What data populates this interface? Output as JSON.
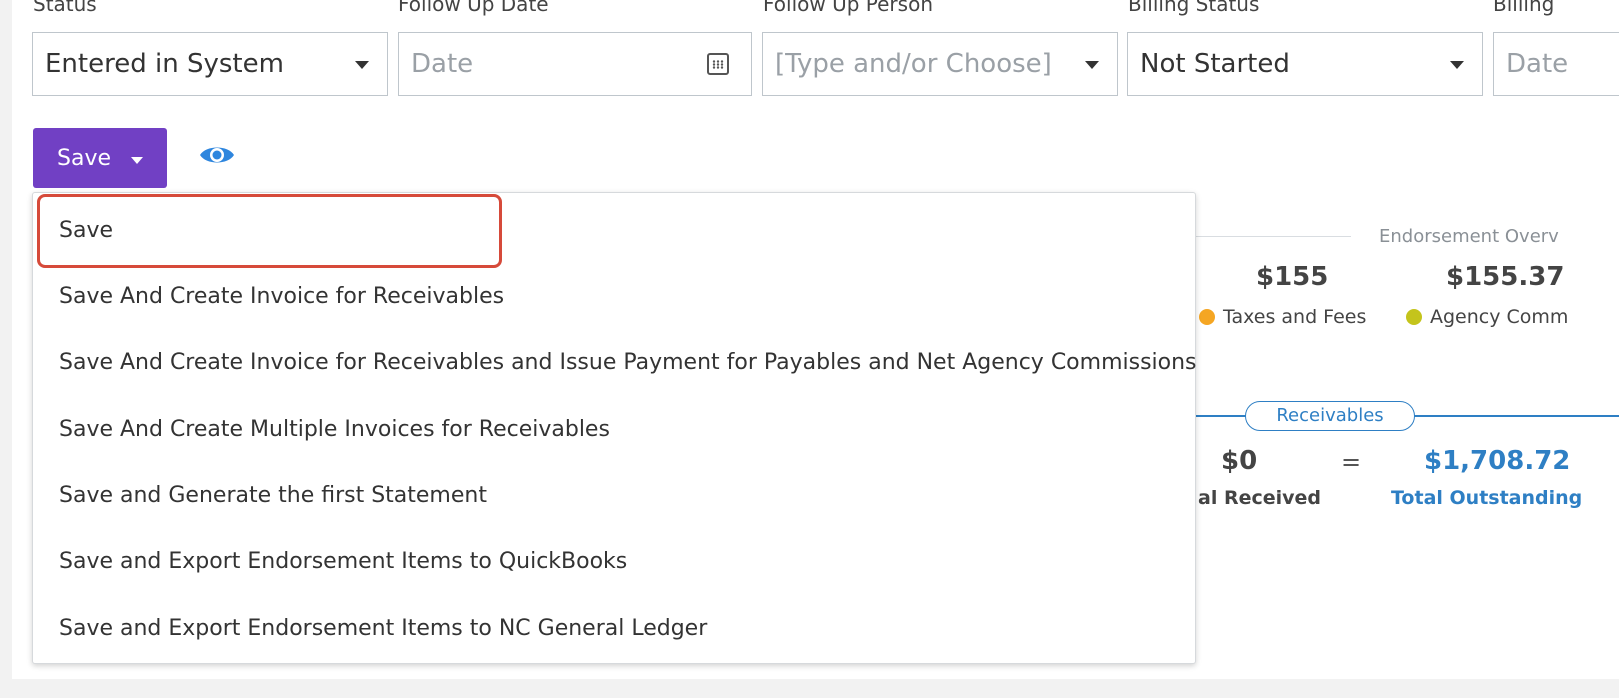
{
  "form": {
    "fields": [
      {
        "label": "Status",
        "value": "Entered in System",
        "placeholder": ""
      },
      {
        "label": "Follow Up Date",
        "value": "",
        "placeholder": "Date"
      },
      {
        "label": "Follow Up Person",
        "value": "",
        "placeholder": "[Type and/or Choose]"
      },
      {
        "label": "Billing Status",
        "value": "Not Started",
        "placeholder": ""
      },
      {
        "label": "Billing",
        "value": "",
        "placeholder": "Date"
      }
    ]
  },
  "toolbar": {
    "save_label": "Save"
  },
  "overview": {
    "section_title": "Endorsement Overv",
    "amount_1": "$155",
    "amount_2": "$155.37",
    "legend_1": "Taxes and Fees",
    "legend_2": "Agency Comm",
    "legend_1_color": "#f5a623",
    "legend_2_color": "#c4c41c",
    "receivables_label": "Receivables",
    "received_value": "$0",
    "equals": "=",
    "outstanding_value": "$1,708.72",
    "received_label": "al Received",
    "outstanding_label": "Total Outstanding"
  },
  "save_menu": {
    "items": [
      "Save",
      "Save And Create Invoice for Receivables",
      "Save And Create Invoice for Receivables and Issue Payment for Payables and Net Agency Commissions",
      "Save And Create Multiple Invoices for Receivables",
      "Save and Generate the first Statement",
      "Save and Export Endorsement Items to QuickBooks",
      "Save and Export Endorsement Items to NC General Ledger"
    ]
  },
  "colors": {
    "accent": "#7140c4",
    "link": "#2e7fc4",
    "highlight": "#d64a3a"
  }
}
